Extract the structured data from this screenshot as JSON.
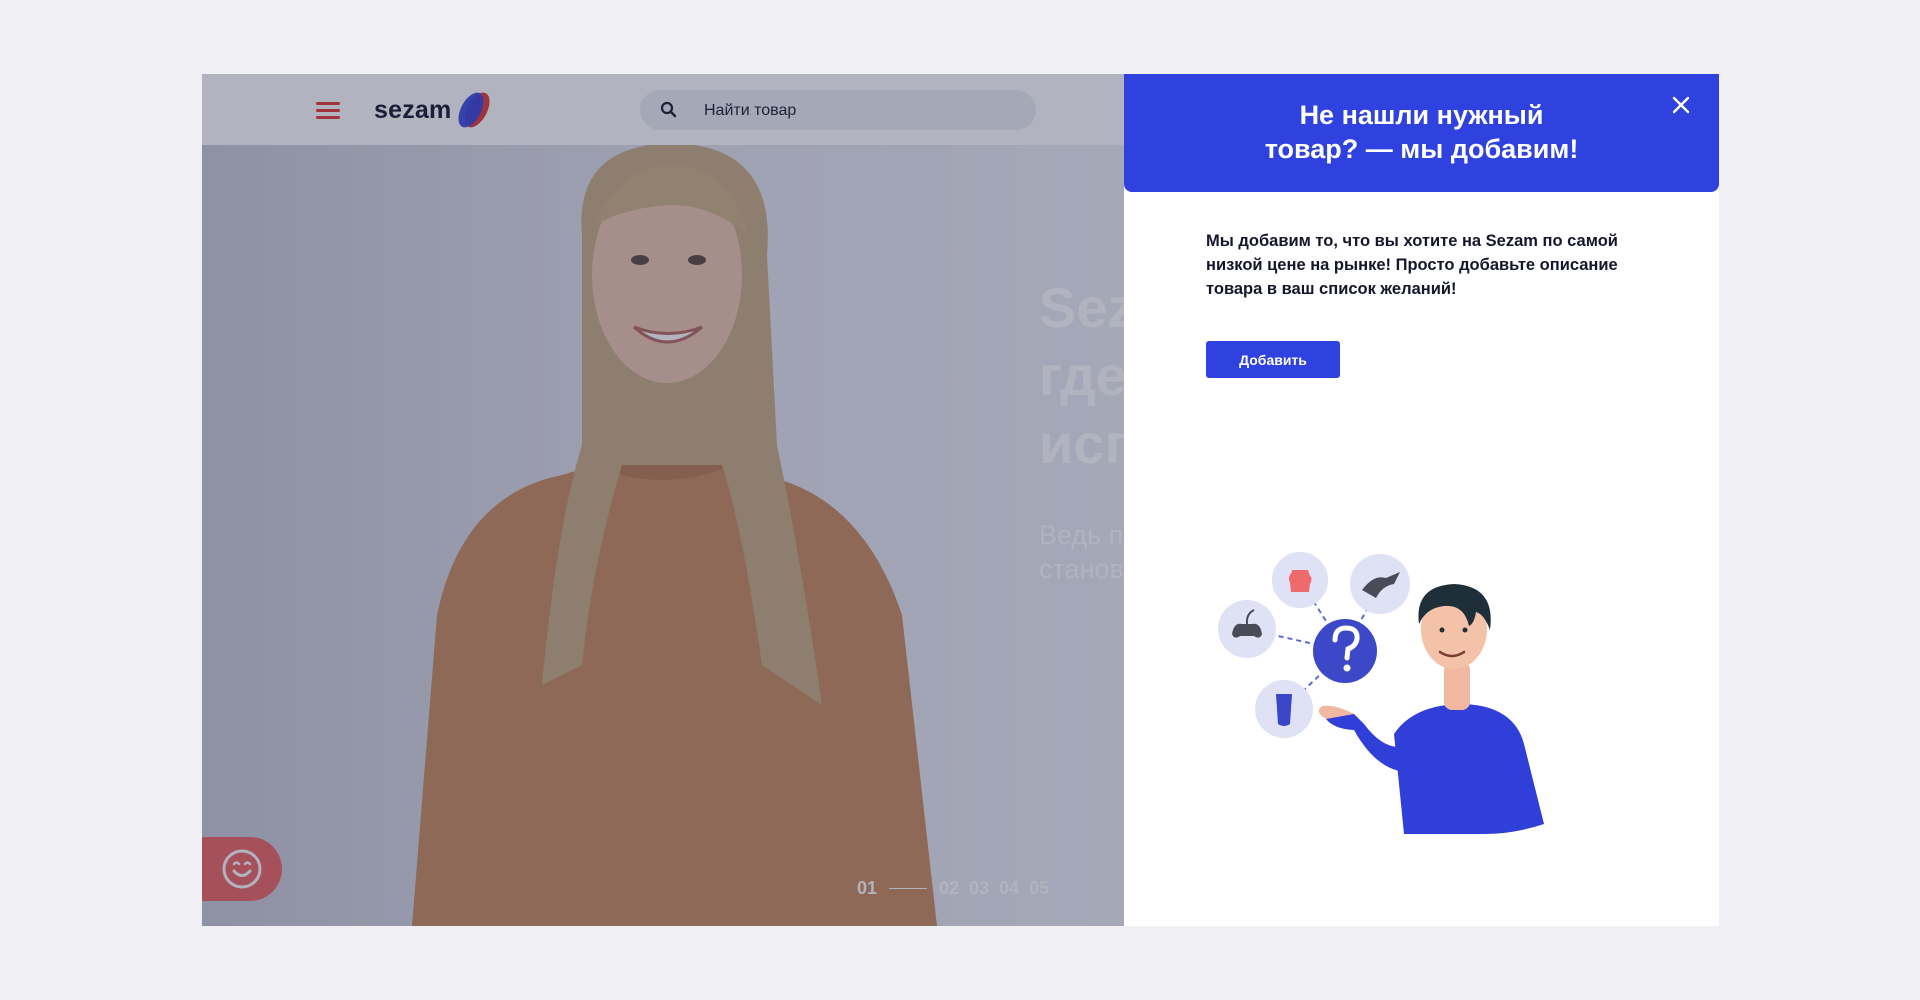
{
  "header": {
    "logo_text": "sezam",
    "search_placeholder": "Найти товар"
  },
  "hero": {
    "title": "Sez\nгде\nисп",
    "subtitle": "Ведь п\nстанов",
    "pager": [
      "01",
      "02",
      "03",
      "04",
      "05"
    ]
  },
  "modal": {
    "title": "Не нашли нужный\nтовар? — мы добавим!",
    "description": "Мы добавим то, что вы хотите на Sezam по самой низкой цене на рынке! Просто добавьте описание товара в ваш список желаний!",
    "add_button_label": "Добавить"
  },
  "icons": {
    "menu": "hamburger-icon",
    "search": "search-icon",
    "close": "close-icon",
    "chat": "smiley-icon"
  },
  "colors": {
    "brand_blue": "#2f41df",
    "accent_red": "#e53935"
  }
}
